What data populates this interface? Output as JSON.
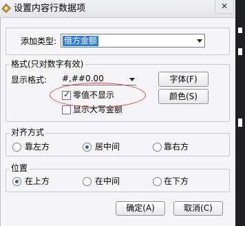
{
  "window": {
    "title": "设置内容行数据项",
    "close_glyph": "✕"
  },
  "add_type": {
    "label": "添加类型:",
    "selected": "借方金额"
  },
  "format_group": {
    "legend": "格式(只对数字有效)",
    "display_format_label": "显示格式:",
    "display_format_value": "#,##0.00",
    "font_button": "字体(F)",
    "color_button": "颜色(S)",
    "zero_hide": {
      "label": "零值不显示",
      "checked": true
    },
    "show_uppercase": {
      "label": "显示大写金额",
      "checked": false
    }
  },
  "align_group": {
    "legend": "对齐方式",
    "options": [
      "靠左方",
      "居中间",
      "靠右方"
    ],
    "selected_index": 1
  },
  "position_group": {
    "legend": "位置",
    "options": [
      "在上方",
      "在中间",
      "在下方"
    ],
    "selected_index": 0
  },
  "buttons": {
    "ok": "确定(A)",
    "cancel": "取消(C)"
  },
  "colors": {
    "selection": "#3478d8",
    "annotation": "#d9443f"
  }
}
